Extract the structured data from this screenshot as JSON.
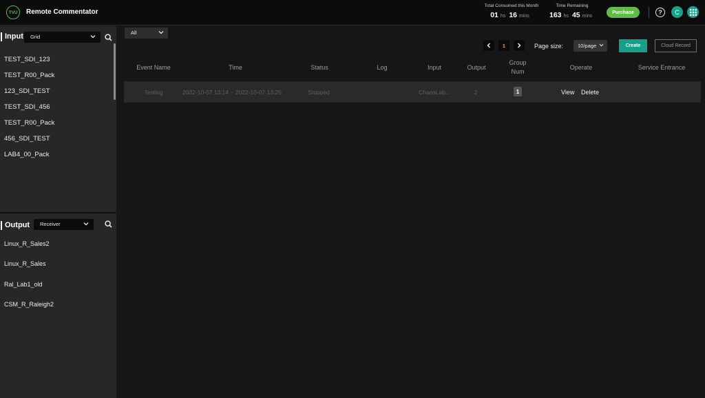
{
  "header": {
    "logo_text": "TVU",
    "app_title": "Remote Commentator",
    "consumed": {
      "label": "Total Consumed this Month",
      "hours": "01",
      "hours_unit": "hs",
      "mins": "16",
      "mins_unit": "mins"
    },
    "remaining": {
      "label": "Time Remaining",
      "hours": "163",
      "hours_unit": "hs",
      "mins": "45",
      "mins_unit": "mins"
    },
    "purchase_label": "Purchase",
    "help_glyph": "?",
    "avatar_letter": "C",
    "icons": [
      "help-icon",
      "user-avatar",
      "apps-grid-icon"
    ]
  },
  "input_panel": {
    "title": "Input",
    "view_select": "Grid",
    "items": [
      "TEST_SDI_123",
      "TEST_R00_Pack",
      "123_SDI_TEST",
      "TEST_SDI_456",
      "TEST_R00_Pack",
      "456_SDI_TEST",
      "LAB4_00_Pack"
    ]
  },
  "output_panel": {
    "title": "Output",
    "type_select": "Receiver",
    "items": [
      "Linux_R_Sales2",
      "Linux_R_Sales",
      "Ral_Lab1_old",
      "CSM_R_Raleigh2"
    ]
  },
  "main": {
    "filter": "All",
    "pagination": {
      "current_page": "1",
      "page_size_label": "Page size:",
      "page_size": "10/page"
    },
    "create_label": "Create",
    "cloud_record_label": "Cloud Record",
    "columns": {
      "event_name": "Event Name",
      "time": "Time",
      "status": "Status",
      "log": "Log",
      "input": "Input",
      "output": "Output",
      "group_num_1": "Group",
      "group_num_2": "Num",
      "operate": "Operate",
      "service_entrance": "Service Entrance"
    },
    "rows": [
      {
        "event_name": "Testing",
        "time": "2022-10-07 13:14 ~ 2022-10-07 13:25",
        "status": "Stopped",
        "log": "",
        "input": "ChaosLab...",
        "output": "2",
        "group_num": "1",
        "view": "View",
        "delete": "Delete",
        "service_entrance": ""
      }
    ]
  },
  "colors": {
    "accent_teal": "#16a08a",
    "purchase_green": "#5fbc44",
    "page_number_orange": "#e9a23b",
    "sidebar_bg": "#272727",
    "main_bg": "#161616"
  }
}
